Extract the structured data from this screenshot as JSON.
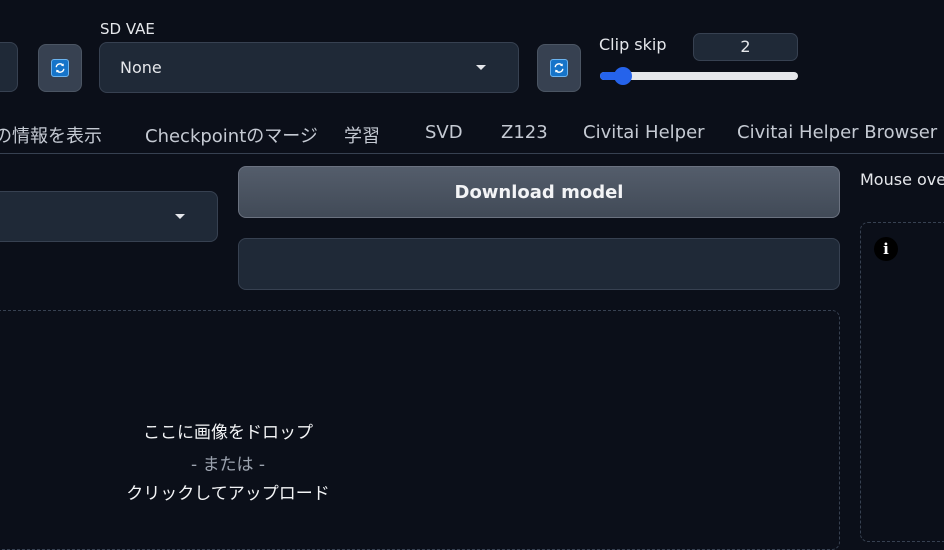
{
  "top": {
    "vae_label": "SD VAE",
    "vae_value": "None",
    "clip_skip_label": "Clip skip",
    "clip_skip_value": "2",
    "clip_skip_slider_fraction": 0.1
  },
  "icons": {
    "refresh": "refresh-icon",
    "caret": "chevron-down-icon",
    "info": "info-icon"
  },
  "tabs": [
    {
      "label": "の情報を表示"
    },
    {
      "label": "Checkpointのマージ"
    },
    {
      "label": "学習"
    },
    {
      "label": "SVD"
    },
    {
      "label": "Z123"
    },
    {
      "label": "Civitai Helper"
    },
    {
      "label": "Civitai Helper Browser"
    }
  ],
  "main": {
    "download_label": "Download model",
    "text_value": "",
    "drop_line1": "ここに画像をドロップ",
    "drop_line2": "- または -",
    "drop_line3": "クリックしてアップロード"
  },
  "right": {
    "hint_label": "Mouse over"
  },
  "colors": {
    "background": "#0b0f19",
    "accent": "#2563eb",
    "refresh_icon": "#1674c9"
  }
}
